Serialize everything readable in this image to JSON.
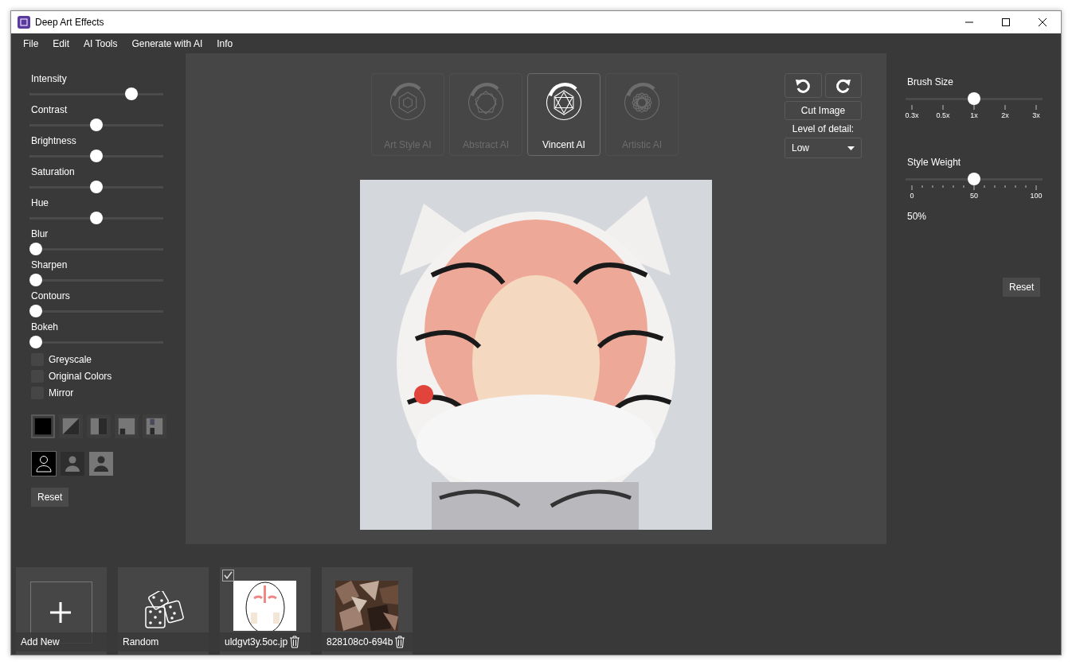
{
  "window": {
    "title": "Deep Art Effects"
  },
  "menu": [
    "File",
    "Edit",
    "AI Tools",
    "Generate with AI",
    "Info"
  ],
  "adjustments": [
    {
      "label": "Intensity",
      "level": 0.79
    },
    {
      "label": "Contrast",
      "level": 0.5
    },
    {
      "label": "Brightness",
      "level": 0.5
    },
    {
      "label": "Saturation",
      "level": 0.5
    },
    {
      "label": "Hue",
      "level": 0.5
    },
    {
      "label": "Blur",
      "level": 0
    },
    {
      "label": "Sharpen",
      "level": 0
    },
    {
      "label": "Contours",
      "level": 0
    },
    {
      "label": "Bokeh",
      "level": 0
    }
  ],
  "options": [
    {
      "label": "Greyscale",
      "checked": false
    },
    {
      "label": "Original Colors",
      "checked": false
    },
    {
      "label": "Mirror",
      "checked": false
    }
  ],
  "mask_modes": [
    {
      "kind": "solid",
      "selected": true
    },
    {
      "kind": "diagonal",
      "selected": false
    },
    {
      "kind": "half",
      "selected": false
    },
    {
      "kind": "corner",
      "selected": false
    },
    {
      "kind": "split",
      "selected": false
    }
  ],
  "subject_modes": [
    {
      "kind": "outline",
      "selected": true
    },
    {
      "kind": "dark",
      "selected": false
    },
    {
      "kind": "light",
      "selected": false
    }
  ],
  "left_reset": "Reset",
  "ai_styles": [
    {
      "label": "Art Style AI",
      "kind": "hexagon",
      "selected": false
    },
    {
      "label": "Abstract AI",
      "kind": "pentagon",
      "selected": false
    },
    {
      "label": "Vincent AI",
      "kind": "star",
      "selected": true
    },
    {
      "label": "Artistic AI",
      "kind": "rosette",
      "selected": false
    }
  ],
  "detail": {
    "cut_button": "Cut Image",
    "label": "Level of detail:",
    "value": "Low"
  },
  "brush_size": {
    "label": "Brush Size",
    "level": 0.5,
    "ticks": [
      "0.3x",
      "0.5x",
      "1x",
      "2x",
      "3x"
    ]
  },
  "style_weight": {
    "label": "Style Weight",
    "level": 0.5,
    "ticks": [
      "0",
      "50",
      "100"
    ],
    "reading": "50%"
  },
  "right_reset": "Reset",
  "gallery": [
    {
      "kind": "add",
      "label": "Add New"
    },
    {
      "kind": "random",
      "label": "Random"
    },
    {
      "label": "uldgvt3y.5oc.jp",
      "checked": true
    },
    {
      "label": "828108c0-694b",
      "checked": false
    }
  ]
}
